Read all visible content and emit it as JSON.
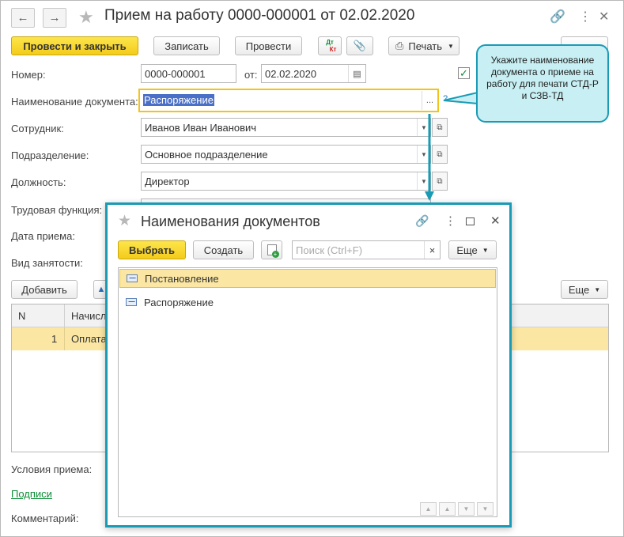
{
  "window": {
    "title": "Прием на работу 0000-000001 от 02.02.2020"
  },
  "toolbar": {
    "post_close": "Провести и закрыть",
    "save": "Записать",
    "post": "Провести",
    "dt_kt_top": "Дт",
    "dt_kt_bottom": "Кт",
    "print": "Печать"
  },
  "form": {
    "number_label": "Номер:",
    "number_value": "0000-000001",
    "from_label": "от:",
    "date_value": "02.02.2020",
    "docname_label": "Наименование документа:",
    "docname_value": "Распоряжение",
    "docname_btn": "...",
    "help_mark": "?",
    "employee_label": "Сотрудник:",
    "employee_value": "Иванов Иван Иванович",
    "dept_label": "Подразделение:",
    "dept_value": "Основное подразделение",
    "position_label": "Должность:",
    "position_value": "Директор",
    "labor_label": "Трудовая функция:",
    "hire_date_label": "Дата приема:",
    "employment_label": "Вид занятости:"
  },
  "tooltip": {
    "text": "Укажите наименование документа о приеме на работу для печати СТД-Р и СЗВ-ТД"
  },
  "table": {
    "add_button": "Добавить",
    "more_button": "Еще",
    "columns": [
      "N",
      "Начисл"
    ],
    "rows": [
      {
        "n": "1",
        "name": "Оплата"
      }
    ]
  },
  "bottom": {
    "conditions_label": "Условия приема:",
    "signatures_link": "Подписи",
    "comment_label": "Комментарий:"
  },
  "popup": {
    "title": "Наименования документов",
    "select_button": "Выбрать",
    "create_button": "Создать",
    "search_placeholder": "Поиск (Ctrl+F)",
    "clear": "×",
    "more_button": "Еще",
    "items": [
      "Постановление",
      "Распоряжение"
    ]
  },
  "colors": {
    "accent": "#1a9bb5",
    "yellow_button": "#f4cc1b",
    "selected_row": "#fbe7a3",
    "link": "#0a8c35"
  }
}
